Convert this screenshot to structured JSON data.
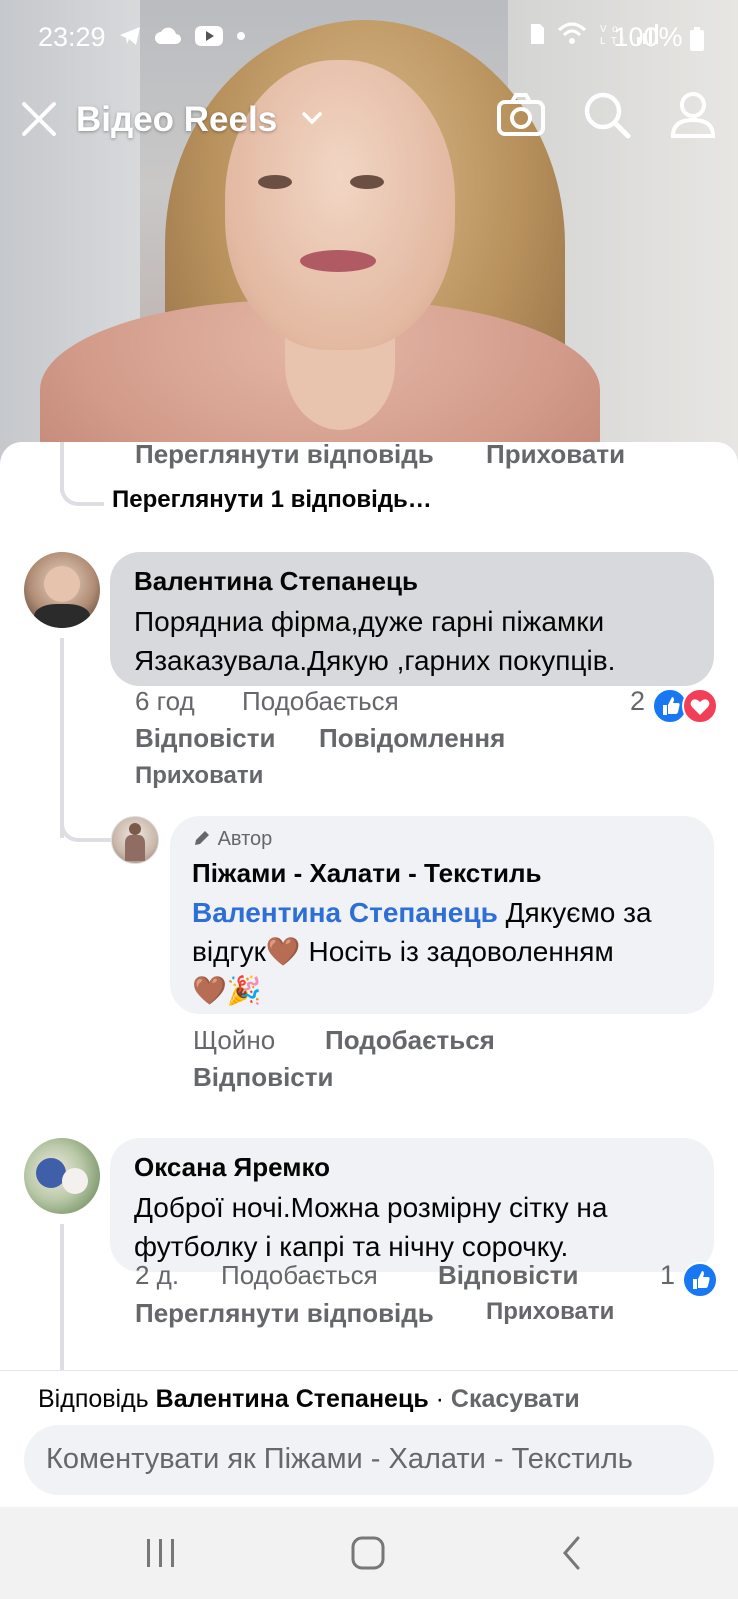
{
  "status_bar": {
    "time": "23:29",
    "left_icons": [
      "telegram-icon",
      "cloud-icon",
      "youtube-icon",
      "dot-icon"
    ],
    "right_icons": [
      "sim-icon",
      "wifi-icon",
      "volte-icon",
      "signal-icon"
    ],
    "battery": "100%"
  },
  "top_bar": {
    "title": "Відео Reels",
    "icons": [
      "close-icon",
      "chevron-down-icon",
      "camera-icon",
      "search-icon",
      "profile-icon"
    ]
  },
  "comments": {
    "prev_actions": {
      "view_reply": "Переглянути відповідь",
      "hide": "Приховати"
    },
    "view_more": "Переглянути 1 відповідь…",
    "c1": {
      "author": "Валентина Степанець",
      "text_line1": "Порядниа фірма,дуже гарні піжамки",
      "text_line2": "Язаказувала.Дякую ,гарних покупців.",
      "time": "6 год",
      "like": "Подобається",
      "reply": "Відповісти",
      "message": "Повідомлення",
      "hide": "Приховати",
      "reaction_count": "2"
    },
    "c1_reply": {
      "badge": "Автор",
      "author": "Піжами - Халати - Текстиль",
      "mention": "Валентина Степанець",
      "text_part1": " Дякуємо за",
      "text_part2": "відгук",
      "text_part3": " Носіть із задоволенням",
      "emoji_heart": "🤎",
      "emoji_party": "🎉",
      "time": "Щойно",
      "like": "Подобається",
      "reply": "Відповісти"
    },
    "c2": {
      "author": "Оксана Яремко",
      "text_line1": "Доброї ночі.Можна розмірну сітку на",
      "text_line2": "футболку і капрі та нічну сорочку.",
      "time": "2 д.",
      "like": "Подобається",
      "reply": "Відповісти",
      "view_reply": "Переглянути відповідь",
      "hide": "Приховати",
      "reaction_count": "1"
    }
  },
  "reply_bar": {
    "prefix": "Відповідь",
    "target": "Валентина Степанець",
    "separator": " · ",
    "cancel": "Скасувати",
    "placeholder": "Коментувати як Піжами - Халати - Текстиль"
  },
  "nav_bar": {
    "icons": [
      "recent-apps-icon",
      "home-icon",
      "back-icon"
    ]
  },
  "colors": {
    "link_blue": "#2d6fd6",
    "like_blue": "#1877f2",
    "love_red": "#f33e58",
    "meta_grey": "#65676b"
  }
}
